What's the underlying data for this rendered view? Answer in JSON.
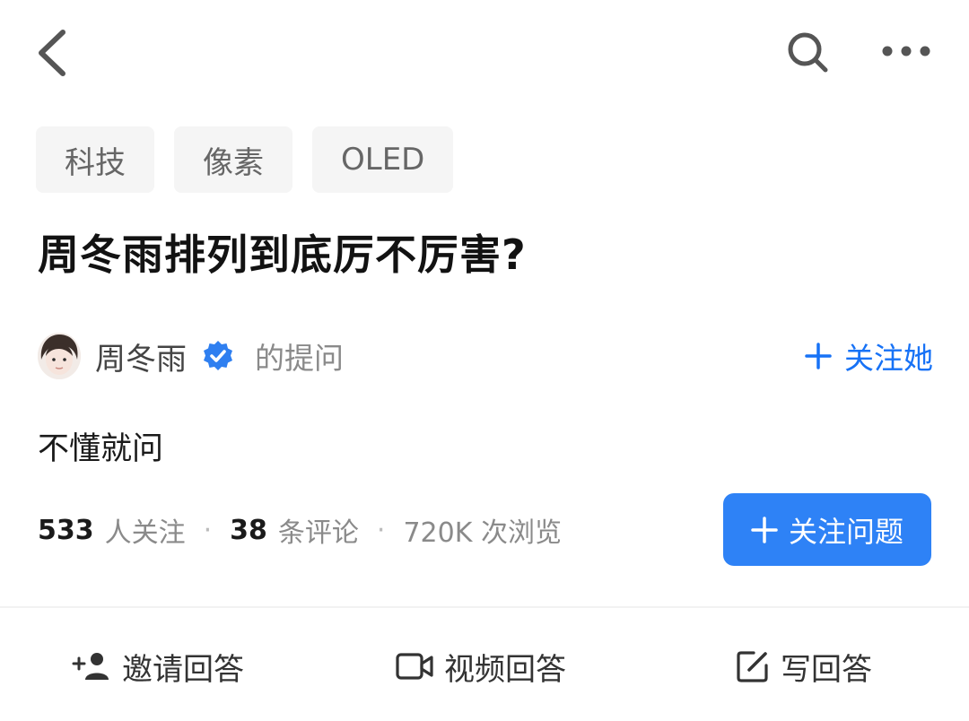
{
  "topbar": {
    "back_icon": "chevron-left-icon",
    "search_icon": "search-icon",
    "more_icon": "more-horizontal-icon"
  },
  "tags": [
    "科技",
    "像素",
    "OLED"
  ],
  "question": {
    "title": "周冬雨排列到底厉不厉害?",
    "description": "不懂就问"
  },
  "author": {
    "name": "周冬雨",
    "suffix": "的提问",
    "verified_icon": "verified-badge-icon",
    "follow_label": "关注她"
  },
  "stats": {
    "followers_count": "533",
    "followers_label": "人关注",
    "comments_count": "38",
    "comments_label": "条评论",
    "views_label": "720K 次浏览",
    "separator": "·"
  },
  "follow_question_button": "关注问题",
  "actions": {
    "invite": "邀请回答",
    "video": "视频回答",
    "write": "写回答"
  },
  "colors": {
    "accent": "#1772f6",
    "button": "#2e82f6",
    "tag_bg": "#f5f5f5",
    "muted": "#8a8a8a"
  }
}
